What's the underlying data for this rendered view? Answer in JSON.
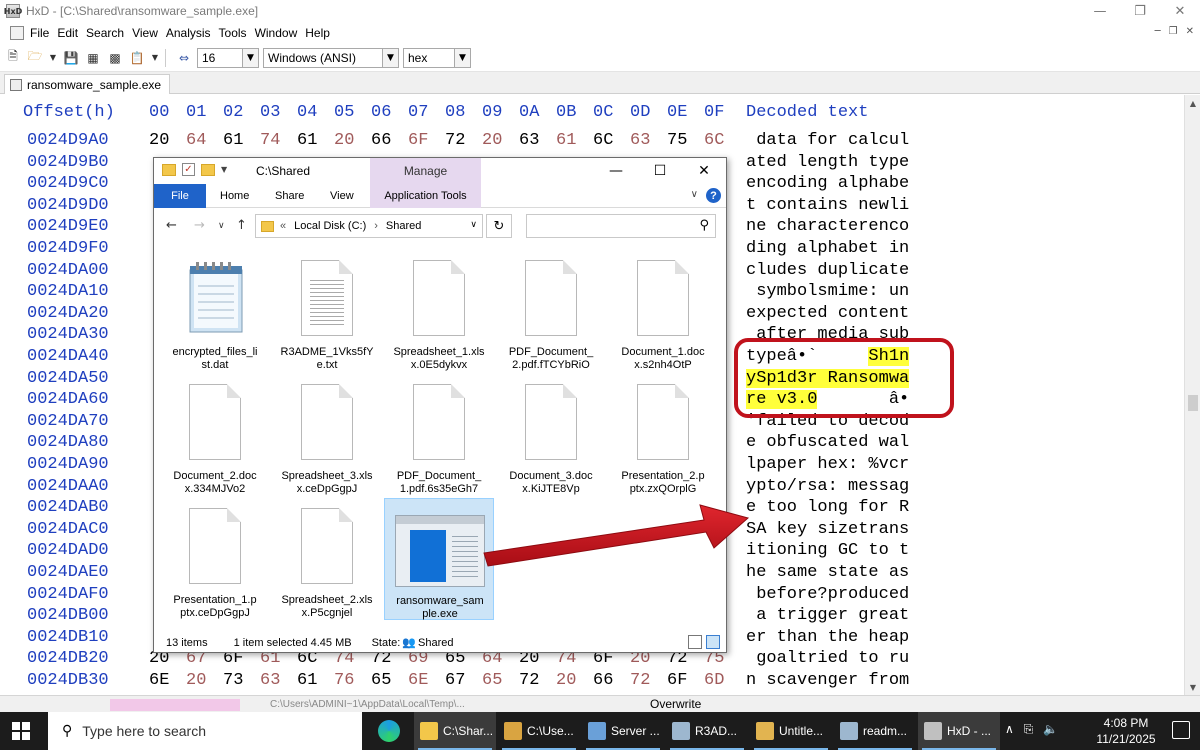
{
  "window": {
    "title": "HxD - [C:\\Shared\\ransomware_sample.exe]",
    "app_icon_letters": "HxD"
  },
  "menu": {
    "items": [
      "File",
      "Edit",
      "Search",
      "View",
      "Analysis",
      "Tools",
      "Window",
      "Help"
    ]
  },
  "toolbar": {
    "bytes_per_row": "16",
    "charset": "Windows (ANSI)",
    "offset_base": "hex"
  },
  "document_tab": {
    "label": "ransomware_sample.exe"
  },
  "hex": {
    "offset_label": "Offset(h)",
    "column_headers": [
      "00",
      "01",
      "02",
      "03",
      "04",
      "05",
      "06",
      "07",
      "08",
      "09",
      "0A",
      "0B",
      "0C",
      "0D",
      "0E",
      "0F"
    ],
    "decoded_label": "Decoded text",
    "rows": [
      {
        "offset": "0024D9A0",
        "bytes": [
          "20",
          "64",
          "61",
          "74",
          "61",
          "20",
          "66",
          "6F",
          "72",
          "20",
          "63",
          "61",
          "6C",
          "63",
          "75",
          "6C"
        ],
        "text": " data for calcul"
      },
      {
        "offset": "0024D9B0",
        "bytes": [],
        "text": "ated length type"
      },
      {
        "offset": "0024D9C0",
        "bytes": [],
        "text": "encoding alphabe"
      },
      {
        "offset": "0024D9D0",
        "bytes": [],
        "text": "t contains newli"
      },
      {
        "offset": "0024D9E0",
        "bytes": [],
        "text": "ne characterenco"
      },
      {
        "offset": "0024D9F0",
        "bytes": [],
        "text": "ding alphabet in"
      },
      {
        "offset": "0024DA00",
        "bytes": [],
        "text": "cludes duplicate"
      },
      {
        "offset": "0024DA10",
        "bytes": [],
        "text": " symbolsmime: un"
      },
      {
        "offset": "0024DA20",
        "bytes": [],
        "text": "expected content"
      },
      {
        "offset": "0024DA30",
        "bytes": [],
        "text": " after media sub"
      },
      {
        "offset": "0024DA40",
        "bytes": [],
        "text": "typeâ•`     ",
        "highlight": "Sh1n"
      },
      {
        "offset": "0024DA50",
        "bytes": [],
        "text": "",
        "highlight": "ySp1d3r Ransomwa"
      },
      {
        "offset": "0024DA60",
        "bytes": [],
        "text": "",
        "highlight": "re v3.0",
        "tail": "       â•"
      },
      {
        "offset": "0024DA70",
        "bytes": [],
        "text": "'failed to decod"
      },
      {
        "offset": "0024DA80",
        "bytes": [],
        "text": "e obfuscated wal"
      },
      {
        "offset": "0024DA90",
        "bytes": [],
        "text": "lpaper hex: %vcr"
      },
      {
        "offset": "0024DAA0",
        "bytes": [],
        "text": "ypto/rsa: messag"
      },
      {
        "offset": "0024DAB0",
        "bytes": [],
        "text": "e too long for R"
      },
      {
        "offset": "0024DAC0",
        "bytes": [],
        "text": "SA key sizetrans"
      },
      {
        "offset": "0024DAD0",
        "bytes": [],
        "text": "itioning GC to t"
      },
      {
        "offset": "0024DAE0",
        "bytes": [],
        "text": "he same state as"
      },
      {
        "offset": "0024DAF0",
        "bytes": [],
        "text": " before?produced"
      },
      {
        "offset": "0024DB00",
        "bytes": [],
        "text": " a trigger great"
      },
      {
        "offset": "0024DB10",
        "bytes": [],
        "text": "er than the heap"
      },
      {
        "offset": "0024DB20",
        "bytes": [
          "20",
          "67",
          "6F",
          "61",
          "6C",
          "74",
          "72",
          "69",
          "65",
          "64",
          "20",
          "74",
          "6F",
          "20",
          "72",
          "75"
        ],
        "text": " goaltried to ru"
      },
      {
        "offset": "0024DB30",
        "bytes": [
          "6E",
          "20",
          "73",
          "63",
          "61",
          "76",
          "65",
          "6E",
          "67",
          "65",
          "72",
          "20",
          "66",
          "72",
          "6F",
          "6D"
        ],
        "text": "n scavenger from"
      }
    ]
  },
  "statusbar": {
    "path": "C:\\Users\\ADMINI~1\\AppData\\Local\\Temp\\...",
    "mode": "Overwrite"
  },
  "explorer": {
    "title": "C:\\Shared",
    "manage_tab": "Manage",
    "ribbon_tabs": [
      "File",
      "Home",
      "Share",
      "View"
    ],
    "app_tools_tab": "Application Tools",
    "address_crumbs": [
      "Local Disk (C:)",
      "Shared"
    ],
    "address_prefix": "«",
    "files": [
      {
        "name": "encrypted_files_list.dat",
        "line1": "encrypted_files_li",
        "line2": "st.dat",
        "kind": "notepad"
      },
      {
        "name": "R3ADME_1Vks5fYe.txt",
        "line1": "R3ADME_1Vks5fY",
        "line2": "e.txt",
        "kind": "text"
      },
      {
        "name": "Spreadsheet_1.xlsx.0E5dykvx",
        "line1": "Spreadsheet_1.xls",
        "line2": "x.0E5dykvx",
        "kind": "blank"
      },
      {
        "name": "PDF_Document_2.pdf.fTCYbRiO",
        "line1": "PDF_Document_",
        "line2": "2.pdf.fTCYbRiO",
        "kind": "blank"
      },
      {
        "name": "Document_1.docx.s2nh4OtP",
        "line1": "Document_1.doc",
        "line2": "x.s2nh4OtP",
        "kind": "blank"
      },
      {
        "name": "Document_2.docx.334MJVo2",
        "line1": "Document_2.doc",
        "line2": "x.334MJVo2",
        "kind": "blank"
      },
      {
        "name": "Spreadsheet_3.xlsx.ceDpGgpJ",
        "line1": "Spreadsheet_3.xls",
        "line2": "x.ceDpGgpJ",
        "kind": "blank"
      },
      {
        "name": "PDF_Document_1.pdf.6s35eGh7",
        "line1": "PDF_Document_",
        "line2": "1.pdf.6s35eGh7",
        "kind": "blank"
      },
      {
        "name": "Document_3.docx.KiJTE8Vp",
        "line1": "Document_3.doc",
        "line2": "x.KiJTE8Vp",
        "kind": "blank"
      },
      {
        "name": "Presentation_2.pptx.zxQOrplG",
        "line1": "Presentation_2.p",
        "line2": "ptx.zxQOrplG",
        "kind": "blank"
      },
      {
        "name": "Presentation_1.pptx.ceDpGgpJ",
        "line1": "Presentation_1.p",
        "line2": "ptx.ceDpGgpJ",
        "kind": "blank"
      },
      {
        "name": "Spreadsheet_2.xlsx.P5cgnjel",
        "line1": "Spreadsheet_2.xls",
        "line2": "x.P5cgnjel",
        "kind": "blank"
      },
      {
        "name": "ransomware_sample.exe",
        "line1": "ransomware_sam",
        "line2": "ple.exe",
        "kind": "exe",
        "selected": true
      }
    ],
    "status": {
      "count": "13 items",
      "selection": "1 item selected  4.45 MB",
      "state_label": "State:",
      "state_value": "Shared"
    }
  },
  "taskbar": {
    "search_placeholder": "Type here to search",
    "tasks": [
      {
        "label": "C:\\Shar...",
        "color": "#f3c74a",
        "active": true
      },
      {
        "label": "C:\\Use...",
        "color": "#d9a441",
        "active": false
      },
      {
        "label": "Server ...",
        "color": "#6aa0d8",
        "active": false
      },
      {
        "label": "R3AD...",
        "color": "#9db7cf",
        "active": false
      },
      {
        "label": "Untitle...",
        "color": "#e2b450",
        "active": false
      },
      {
        "label": "readm...",
        "color": "#9db7cf",
        "active": false
      },
      {
        "label": "HxD - ...",
        "color": "#c0c0c0",
        "active": true
      }
    ],
    "time": "4:08 PM",
    "date": "11/21/2025"
  },
  "colors": {
    "hex_blue": "#1f3fbf",
    "highlight_yellow": "#ffff3a",
    "annotation_red": "#c0121c",
    "explorer_blue": "#1f63c9"
  }
}
